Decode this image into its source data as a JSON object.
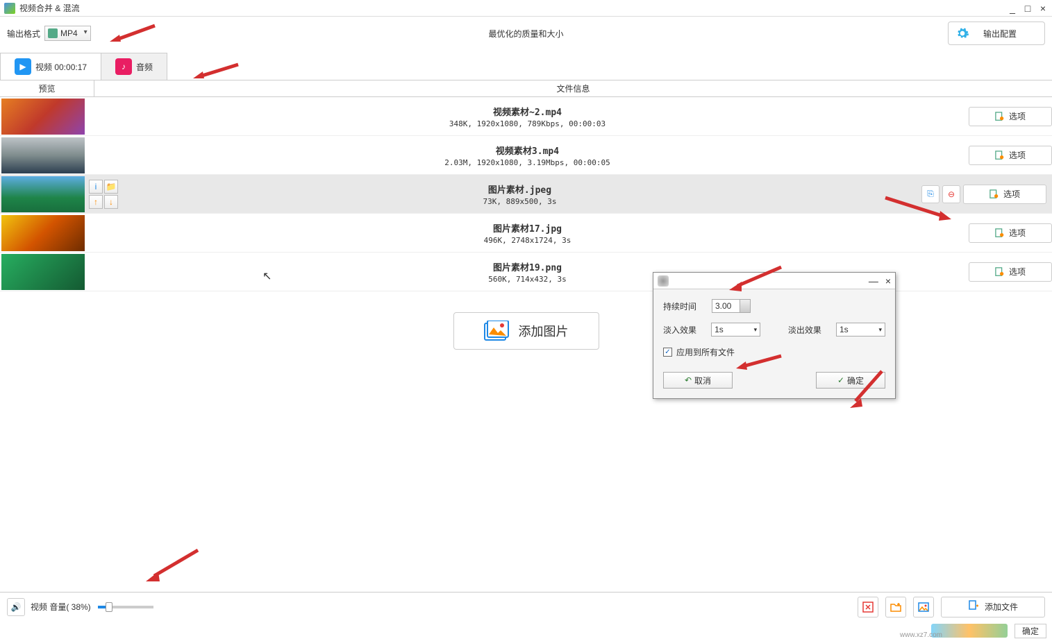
{
  "window": {
    "title": "视频合并 & 混流",
    "minimize": "_",
    "maximize": "□",
    "close": "×"
  },
  "top": {
    "output_format_label": "输出格式",
    "output_format_value": "MP4",
    "quality_text": "最优化的质量和大小",
    "output_config_label": "输出配置"
  },
  "tabs": {
    "video_label": "视频 00:00:17",
    "audio_label": "音频"
  },
  "columns": {
    "preview": "预览",
    "fileinfo": "文件信息"
  },
  "files": [
    {
      "name": "视频素材~2.mp4",
      "meta": "348K, 1920x1080, 789Kbps, 00:00:03",
      "options": "选项"
    },
    {
      "name": "视频素材3.mp4",
      "meta": "2.03M, 1920x1080, 3.19Mbps, 00:00:05",
      "options": "选项"
    },
    {
      "name": "图片素材.jpeg",
      "meta": "73K, 889x500, 3s",
      "options": "选项",
      "selected": true
    },
    {
      "name": "图片素材17.jpg",
      "meta": "496K, 2748x1724, 3s",
      "options": "选项"
    },
    {
      "name": "图片素材19.png",
      "meta": "560K, 714x432, 3s",
      "options": "选项"
    }
  ],
  "add_image_label": "添加图片",
  "bottom": {
    "volume_label": "视频 音量( 38%)",
    "add_file_label": "添加文件",
    "ok_label": "确定"
  },
  "dialog": {
    "minimize": "—",
    "close": "×",
    "duration_label": "持续时间",
    "duration_value": "3.00",
    "fadein_label": "淡入效果",
    "fadein_value": "1s",
    "fadeout_label": "淡出效果",
    "fadeout_value": "1s",
    "apply_all_label": "应用到所有文件",
    "apply_all_checked": "✓",
    "cancel_label": "取消",
    "ok_label": "确定"
  },
  "watermark": {
    "site": "www.xz7.com"
  },
  "icons": {
    "info": "i",
    "folder": "📁",
    "up": "↑",
    "down": "↓",
    "copy": "⎘",
    "remove": "⊖",
    "play": "▶",
    "music": "♪",
    "speaker": "🔊",
    "undo": "↶",
    "check": "✓"
  }
}
